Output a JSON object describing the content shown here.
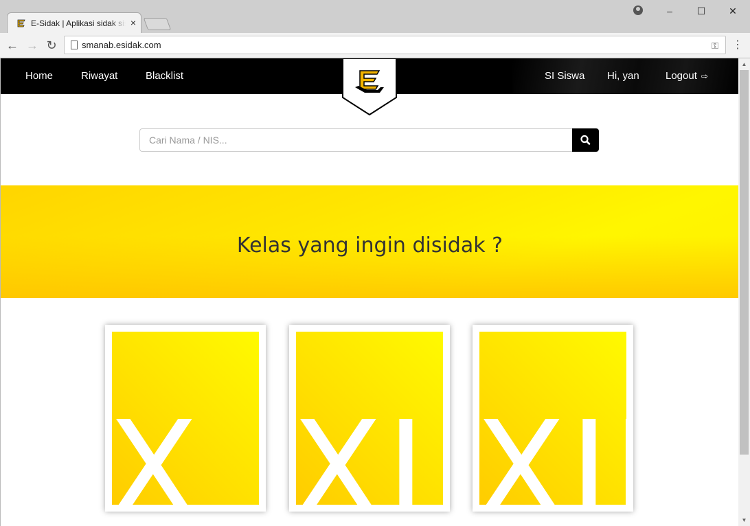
{
  "browser": {
    "tab_title": "E-Sidak | Aplikasi sidak siswa",
    "tab_close": "×",
    "url": "smanab.esidak.com",
    "win_minimize": "–",
    "win_maximize": "☐",
    "win_close": "✕",
    "back": "←",
    "forward": "→",
    "reload": "↻",
    "menu": "⋮",
    "key": "⚿"
  },
  "navbar": {
    "left": [
      "Home",
      "Riwayat",
      "Blacklist"
    ],
    "right": [
      "SI Siswa",
      "Hi, yan",
      "Logout"
    ],
    "logout_icon": "⇨"
  },
  "search": {
    "placeholder": "Cari Nama / NIS...",
    "value": ""
  },
  "hero": {
    "title": "Kelas yang ingin disidak ?"
  },
  "classes": [
    "X",
    "XI",
    "XII"
  ],
  "colors": {
    "brand_yellow": "#FFE600",
    "brand_orange": "#F5B800",
    "navbar_bg": "#000000"
  }
}
